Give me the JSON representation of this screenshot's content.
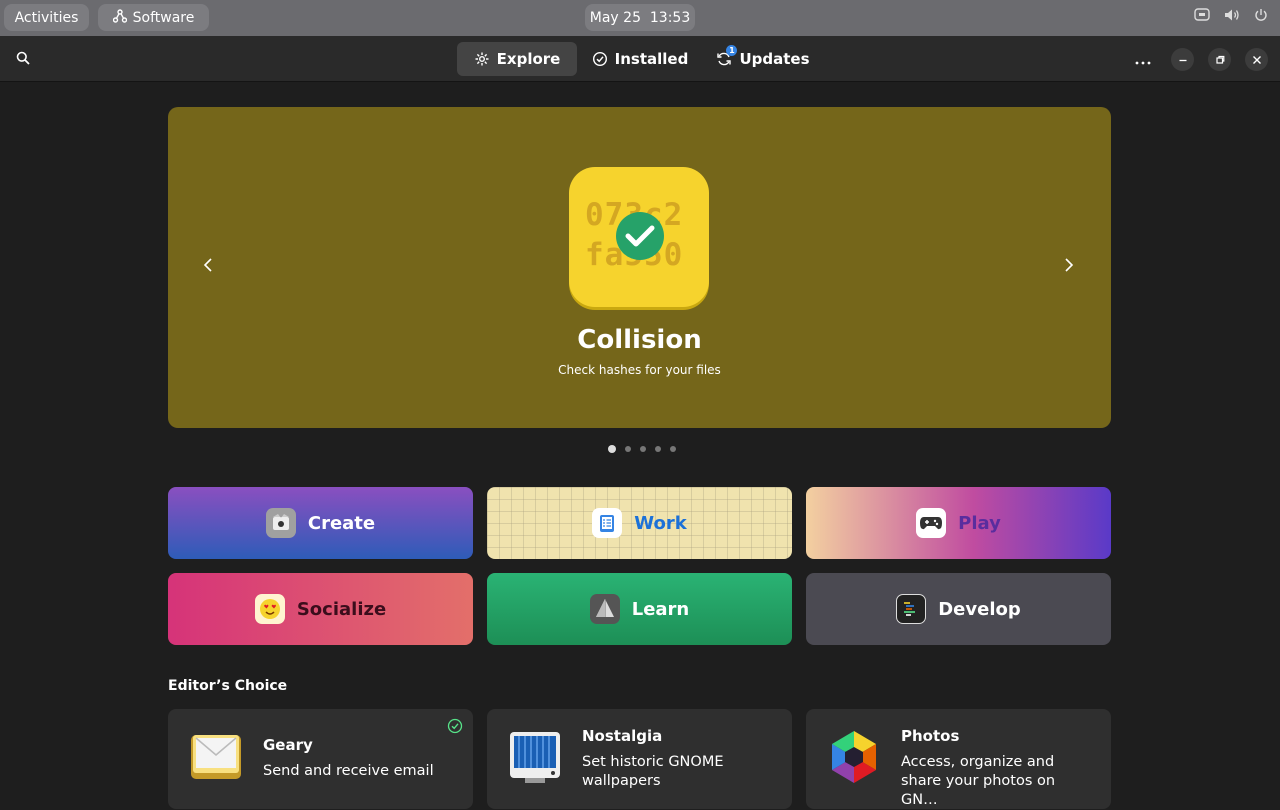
{
  "topbar": {
    "activities": "Activities",
    "app_name": "Software",
    "clock": "May 25  13:53"
  },
  "header": {
    "tabs": [
      {
        "label": "Explore",
        "active": true
      },
      {
        "label": "Installed",
        "active": false
      },
      {
        "label": "Updates",
        "active": false,
        "badge": "1"
      }
    ]
  },
  "featured": {
    "title": "Collision",
    "subtitle": "Check hashes for your files",
    "icon_hash_line1": "073c2",
    "icon_hash_line2": "fa550",
    "background": "#75661a",
    "page_index": 1,
    "page_count": 5
  },
  "categories": [
    {
      "label": "Create"
    },
    {
      "label": "Work"
    },
    {
      "label": "Play"
    },
    {
      "label": "Socialize"
    },
    {
      "label": "Learn"
    },
    {
      "label": "Develop"
    }
  ],
  "editors_choice": {
    "title": "Editor’s Choice",
    "apps": [
      {
        "name": "Geary",
        "description": "Send and receive email",
        "installed": true
      },
      {
        "name": "Nostalgia",
        "description": "Set historic GNOME wallpapers",
        "installed": false
      },
      {
        "name": "Photos",
        "description": "Access, organize and share your photos on GN…",
        "installed": false
      }
    ]
  },
  "colors": {
    "accent": "#3584e4",
    "installed_check": "#57e389"
  }
}
